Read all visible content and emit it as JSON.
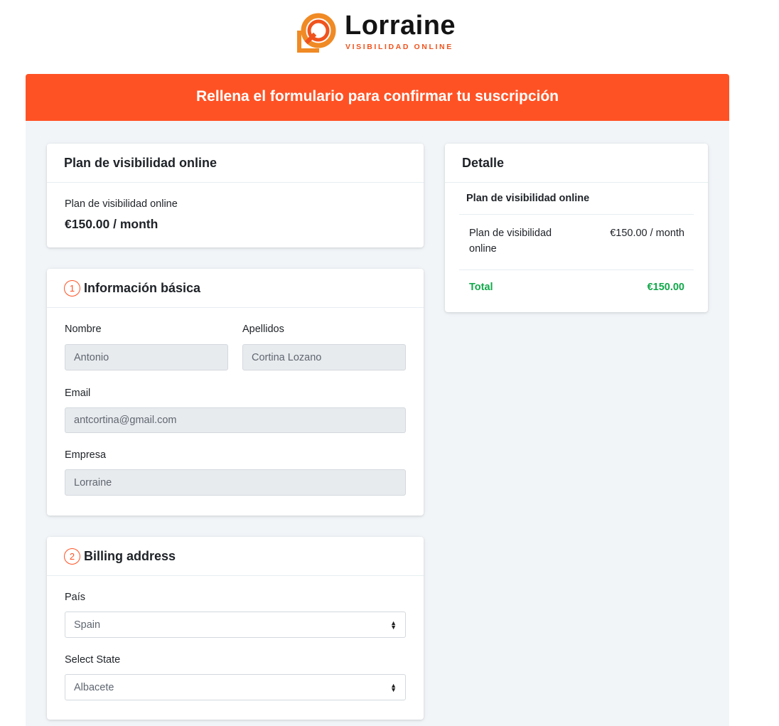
{
  "brand": {
    "name": "Lorraine",
    "tagline": "VISIBILIDAD ONLINE",
    "accent": "#ff5224"
  },
  "banner": {
    "title": "Rellena el formulario para confirmar tu suscripción"
  },
  "plan_card": {
    "header": "Plan de visibilidad online",
    "plan_name": "Plan de visibilidad online",
    "price": "€150.00 / month"
  },
  "basic_info": {
    "step": "1",
    "header": "Información básica",
    "first_name": {
      "label": "Nombre",
      "value": "Antonio"
    },
    "last_name": {
      "label": "Apellidos",
      "value": "Cortina Lozano"
    },
    "email": {
      "label": "Email",
      "value": "antcortina@gmail.com"
    },
    "company": {
      "label": "Empresa",
      "value": "Lorraine"
    }
  },
  "billing": {
    "step": "2",
    "header": "Billing address",
    "country": {
      "label": "País",
      "value": "Spain"
    },
    "state": {
      "label": "Select State",
      "value": "Albacete"
    }
  },
  "detail": {
    "header": "Detalle",
    "subtitle": "Plan de visibilidad online",
    "line_item": {
      "name": "Plan de visibilidad online",
      "price": "€150.00 / month"
    },
    "total": {
      "label": "Total",
      "value": "€150.00",
      "color": "#11a84a"
    }
  }
}
